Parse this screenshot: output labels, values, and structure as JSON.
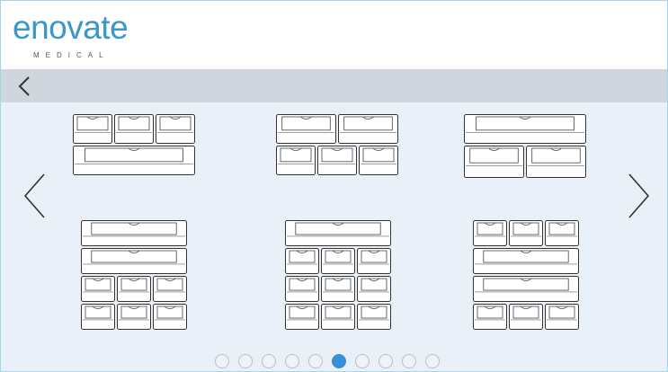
{
  "brand": {
    "name": "enovate",
    "tagline": "MEDICAL",
    "color": "#3a97c8"
  },
  "nav": {
    "back_icon": "chevron-left-icon",
    "prev_icon": "chevron-left-icon",
    "next_icon": "chevron-right-icon"
  },
  "configurations": [
    {
      "id": "config-1",
      "rows": [
        [
          1,
          1,
          1
        ],
        [
          1
        ]
      ]
    },
    {
      "id": "config-2",
      "rows": [
        [
          1,
          1
        ],
        [
          1,
          1,
          1
        ]
      ]
    },
    {
      "id": "config-3",
      "rows": [
        [
          1
        ],
        [
          1,
          1
        ]
      ]
    },
    {
      "id": "config-4",
      "rows": [
        [
          1
        ],
        [
          1
        ],
        [
          1,
          1,
          1
        ],
        [
          1,
          1,
          1
        ]
      ]
    },
    {
      "id": "config-5",
      "rows": [
        [
          1
        ],
        [
          1,
          1,
          1
        ],
        [
          1,
          1,
          1
        ],
        [
          1,
          1,
          1
        ]
      ]
    },
    {
      "id": "config-6",
      "rows": [
        [
          1,
          1,
          1
        ],
        [
          1
        ],
        [
          1
        ],
        [
          1,
          1,
          1
        ]
      ]
    }
  ],
  "pagination": {
    "total": 10,
    "active_index": 5,
    "active_color": "#3a8fd6"
  }
}
